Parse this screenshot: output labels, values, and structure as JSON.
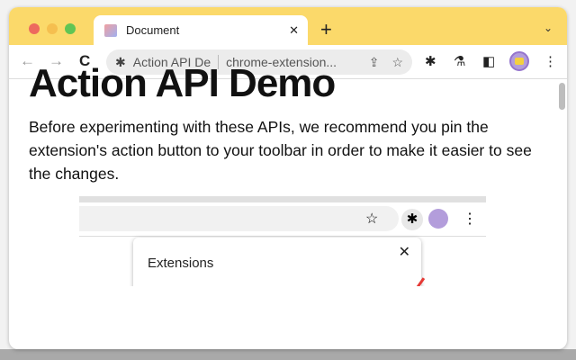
{
  "tab": {
    "title": "Document",
    "close": "✕",
    "new_tab": "+",
    "list": "⌄"
  },
  "toolbar": {
    "back": "←",
    "forward": "→",
    "reload": "C",
    "page_title": "Action API De",
    "url": "chrome-extension...",
    "share": "⇪",
    "star": "☆",
    "extensions": "✱",
    "labs": "⚗",
    "sidebar": "◧",
    "menu": "⋮"
  },
  "page": {
    "heading": "Action API Demo",
    "intro": "Before experimenting with these APIs, we recommend you pin the extension's action button to your toolbar in order to make it easier to see the changes.",
    "screenshot": {
      "star": "☆",
      "extensions": "✱",
      "menu": "⋮",
      "popup_title": "Extensions",
      "popup_close": "✕"
    }
  }
}
